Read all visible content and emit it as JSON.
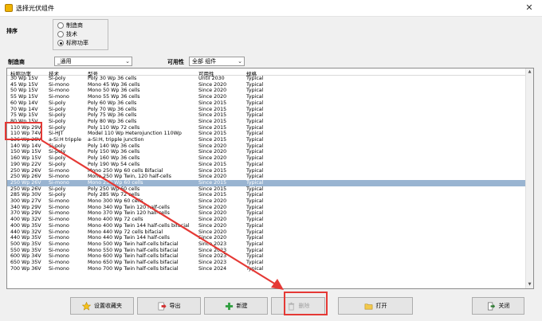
{
  "window": {
    "title": "选择光伏组件",
    "close_glyph": "✕"
  },
  "sort": {
    "label": "排序",
    "options": [
      {
        "label": "制造商",
        "checked": false
      },
      {
        "label": "技术",
        "checked": false
      },
      {
        "label": "标称功率",
        "checked": true
      }
    ]
  },
  "filters": {
    "manufacturer_label": "制造商",
    "manufacturer_value": "_通用",
    "availability_label": "可用性",
    "availability_value": "全部 组件"
  },
  "table": {
    "columns": [
      "标称功率",
      "技术",
      "型号",
      "可用性",
      "规格"
    ],
    "selected_index": 17,
    "rows": [
      [
        "30 Wp 15V",
        "Si-poly",
        "Poly 30 Wp 36 cells",
        "Until 2030",
        "Typical"
      ],
      [
        "45 Wp 15V",
        "Si-mono",
        "Mono 45 Wp 36 cells",
        "Since 2020",
        "Typical"
      ],
      [
        "50 Wp 15V",
        "Si-mono",
        "Mono 50 Wp 36 cells",
        "Since 2020",
        "Typical"
      ],
      [
        "55 Wp 15V",
        "Si-mono",
        "Mono 55 Wp 36 cells",
        "Since 2020",
        "Typical"
      ],
      [
        "60 Wp 14V",
        "Si-poly",
        "Poly 60 Wp  36 cells",
        "Since 2015",
        "Typical"
      ],
      [
        "70 Wp 14V",
        "Si-poly",
        "Poly 70 Wp 36 cells",
        "Since 2015",
        "Typical"
      ],
      [
        "75 Wp 15V",
        "Si-poly",
        "Poly 75 Wp 36 cells",
        "Since 2015",
        "Typical"
      ],
      [
        "80 Wp 15V",
        "Si-poly",
        "Poly 80 Wp 36 cells",
        "Since 2015",
        "Typical"
      ],
      [
        "110 Wp 29V",
        "Si-poly",
        "Poly 110 Wp  72 cells",
        "Since 2015",
        "Typical"
      ],
      [
        "110 Wp 74V",
        "Si-HJT",
        "Model 110 Wp Heterojunction 110Wp",
        "Since 2015",
        "Typical"
      ],
      [
        "136 Wp 28V",
        "a-Si:H tripple",
        "a-Si:H, tripple junction",
        "Since 2015",
        "Typical"
      ],
      [
        "140 Wp 14V",
        "Si-poly",
        "Poly 140 Wp 36 cells",
        "Since 2020",
        "Typical"
      ],
      [
        "150 Wp 15V",
        "Si-poly",
        "Poly 150 Wp 36 cells",
        "Since 2020",
        "Typical"
      ],
      [
        "160 Wp 15V",
        "Si-poly",
        "Poly 160 Wp 36 cells",
        "Since 2020",
        "Typical"
      ],
      [
        "190 Wp 22V",
        "Si-poly",
        "Poly 190 Wp  54 cells",
        "Since 2015",
        "Typical"
      ],
      [
        "250 Wp 26V",
        "Si-mono",
        "Mono 250 Wp  60 cells Bifacial",
        "Since 2015",
        "Typical"
      ],
      [
        "250 Wp 26V",
        "Si-mono",
        "Mono 250 Wp  Twin, 120 half-cells",
        "Since 2020",
        "Typical"
      ],
      [
        "250 Wp 26V",
        "Si-mono",
        "Mono 250 Wp  60 cells",
        "Since 2015",
        "Typical"
      ],
      [
        "250 Wp 26V",
        "Si-poly",
        "Poly 250 Wp  60 cells",
        "Since 2015",
        "Typical"
      ],
      [
        "285 Wp 30V",
        "Si-poly",
        "Poly 285 Wp  72 cells",
        "Since 2015",
        "Typical"
      ],
      [
        "300 Wp 27V",
        "Si-mono",
        "Mono 300 Wp 60 cells",
        "Since 2020",
        "Typical"
      ],
      [
        "340 Wp 29V",
        "Si-mono",
        "Mono 340 Wp Twin 120 half-cells",
        "Since 2020",
        "Typical"
      ],
      [
        "370 Wp 29V",
        "Si-mono",
        "Mono 370 Wp Twin 120 half-cells",
        "Since 2020",
        "Typical"
      ],
      [
        "400 Wp 32V",
        "Si-mono",
        "Mono 400 Wp 72 cells",
        "Since 2020",
        "Typical"
      ],
      [
        "400 Wp 35V",
        "Si-mono",
        "Mono 400 Wp Twin 144 half-cells bifacial",
        "Since 2020",
        "Typical"
      ],
      [
        "440 Wp 32V",
        "Si-mono",
        "Mono 440 Wp 72 cells bifacial",
        "Since 2020",
        "Typical"
      ],
      [
        "440 Wp 35V",
        "Si-mono",
        "Mono 440 Wp Twin 144 half-cells",
        "Since 2020",
        "Typical"
      ],
      [
        "500 Wp 35V",
        "Si-mono",
        "Mono 500 Wp Twin half-cells bifacial",
        "Since 2023",
        "Typical"
      ],
      [
        "550 Wp 35V",
        "Si-mono",
        "Mono 550 Wp Twin half-cells bifacial",
        "Since 2023",
        "Typical"
      ],
      [
        "600 Wp 34V",
        "Si-mono",
        "Mono 600 Wp Twin half-cells bifacial",
        "Since 2023",
        "Typical"
      ],
      [
        "650 Wp 35V",
        "Si-mono",
        "Mono 650 Wp Twin half-cells bifacial",
        "Since 2023",
        "Typical"
      ],
      [
        "700 Wp 36V",
        "Si-mono",
        "Mono 700 Wp Twin half-cells bifacial",
        "Since 2024",
        "Typical"
      ]
    ]
  },
  "buttons": {
    "favorites": {
      "label": "设置收藏夹",
      "icon": "star-icon"
    },
    "export": {
      "label": "导出",
      "icon": "export-icon"
    },
    "new": {
      "label": "新建",
      "icon": "plus-icon"
    },
    "delete": {
      "label": "删除",
      "icon": "trash-icon",
      "enabled": false
    },
    "open": {
      "label": "打开",
      "icon": "folder-icon"
    },
    "close": {
      "label": "关闭",
      "icon": "exit-icon"
    }
  },
  "colors": {
    "selection": "#99b4d1",
    "annotation": "#e53935"
  }
}
